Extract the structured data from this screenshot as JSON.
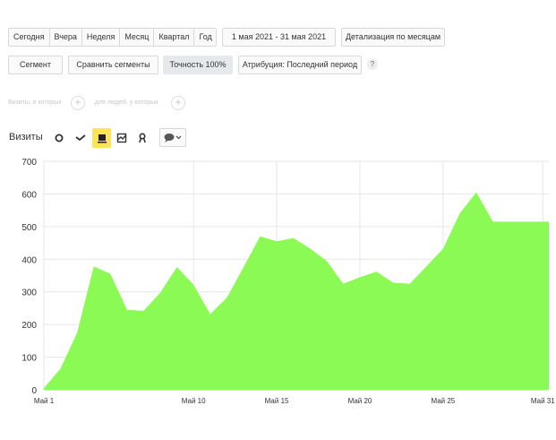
{
  "toolbar": {
    "periods": [
      "Сегодня",
      "Вчера",
      "Неделя",
      "Месяц",
      "Квартал",
      "Год"
    ],
    "date_range": "1 мая 2021 - 31 мая 2021",
    "detail": "Детализация по месяцам"
  },
  "segment_bar": {
    "segment": "Сегмент",
    "compare": "Сравнить сегменты",
    "accuracy": "Точность 100%",
    "attribution": "Атрибуция: Последний период",
    "help": "?"
  },
  "filters": {
    "left_hint": "Визиты, в которых",
    "right_hint": "для людей, у которых",
    "plus": "+"
  },
  "chart_controls": {
    "metric": "Визиты",
    "types": [
      {
        "icon": "circle-icon",
        "active": false
      },
      {
        "icon": "line-icon",
        "active": false
      },
      {
        "icon": "area-chart-icon",
        "active": true
      },
      {
        "icon": "stacked-chart-icon",
        "active": false
      },
      {
        "icon": "ribbon-icon",
        "active": false
      }
    ],
    "comment_icon": "comment-icon"
  },
  "colors": {
    "area": "#8cfa55",
    "accent": "#ffe35a"
  },
  "chart_data": {
    "type": "area",
    "xlabel": "",
    "ylabel": "",
    "x_tick_labels": [
      "Май 1",
      "Май 10",
      "Май 15",
      "Май 20",
      "Май 25",
      "Май 31"
    ],
    "x_tick_days": [
      1,
      10,
      15,
      20,
      25,
      31
    ],
    "x": [
      1,
      2,
      3,
      4,
      5,
      6,
      7,
      8,
      9,
      10,
      11,
      12,
      13,
      14,
      15,
      16,
      17,
      18,
      19,
      20,
      21,
      22,
      23,
      24,
      25,
      26,
      27,
      28,
      29,
      30,
      31,
      32
    ],
    "series": [
      {
        "values": [
          5,
          65,
          175,
          378,
          355,
          245,
          242,
          298,
          376,
          322,
          232,
          282,
          375,
          470,
          455,
          465,
          433,
          395,
          325,
          345,
          362,
          328,
          325,
          378,
          432,
          540,
          605,
          515,
          515,
          515,
          515,
          515
        ]
      }
    ],
    "ylim": [
      0,
      700
    ],
    "y_ticks": [
      0,
      100,
      200,
      300,
      400,
      500,
      600,
      700
    ],
    "grid": true
  }
}
